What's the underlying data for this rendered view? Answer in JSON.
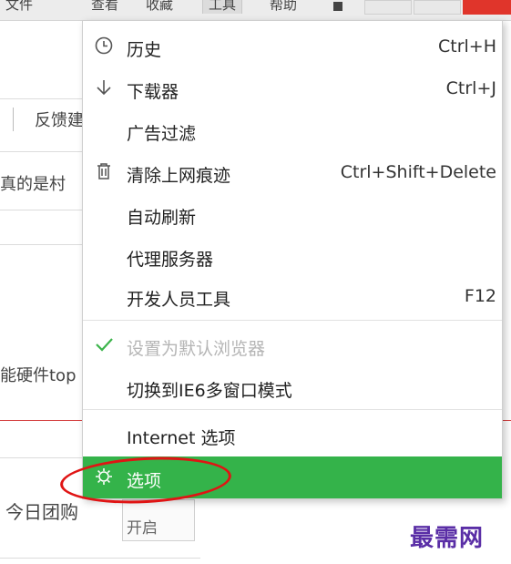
{
  "menubar": {
    "items": [
      "文件",
      "查看",
      "收藏",
      "工具",
      "帮助"
    ]
  },
  "background": {
    "feedback": "反馈建",
    "prefix_text": "真的是村",
    "hardware_text": "能硬件top",
    "today_group": "今日团购",
    "switch_label": "开启"
  },
  "menu": {
    "items": [
      {
        "icon": "clock-icon",
        "label": "历史",
        "shortcut": "Ctrl+H"
      },
      {
        "icon": "download-arrow-icon",
        "label": "下载器",
        "shortcut": "Ctrl+J"
      },
      {
        "icon": "",
        "label": "广告过滤",
        "shortcut": ""
      },
      {
        "icon": "trash-icon",
        "label": "清除上网痕迹",
        "shortcut": "Ctrl+Shift+Delete"
      },
      {
        "icon": "",
        "label": "自动刷新",
        "shortcut": ""
      },
      {
        "icon": "",
        "label": "代理服务器",
        "shortcut": ""
      },
      {
        "icon": "",
        "label": "开发人员工具",
        "shortcut": "F12"
      },
      {
        "icon": "checkmark-icon",
        "label": "设置为默认浏览器",
        "shortcut": "",
        "disabled": true
      },
      {
        "icon": "",
        "label": "切换到IE6多窗口模式",
        "shortcut": ""
      },
      {
        "icon": "",
        "label": "Internet 选项",
        "shortcut": ""
      },
      {
        "icon": "gear-icon",
        "label": "选项",
        "shortcut": "",
        "selected": true
      }
    ]
  },
  "watermark": "最需网",
  "colors": {
    "selected_bg": "#34b34a",
    "check_green": "#3cb44b",
    "highlight_circle": "#e01414",
    "watermark": "#5a2ea6"
  }
}
